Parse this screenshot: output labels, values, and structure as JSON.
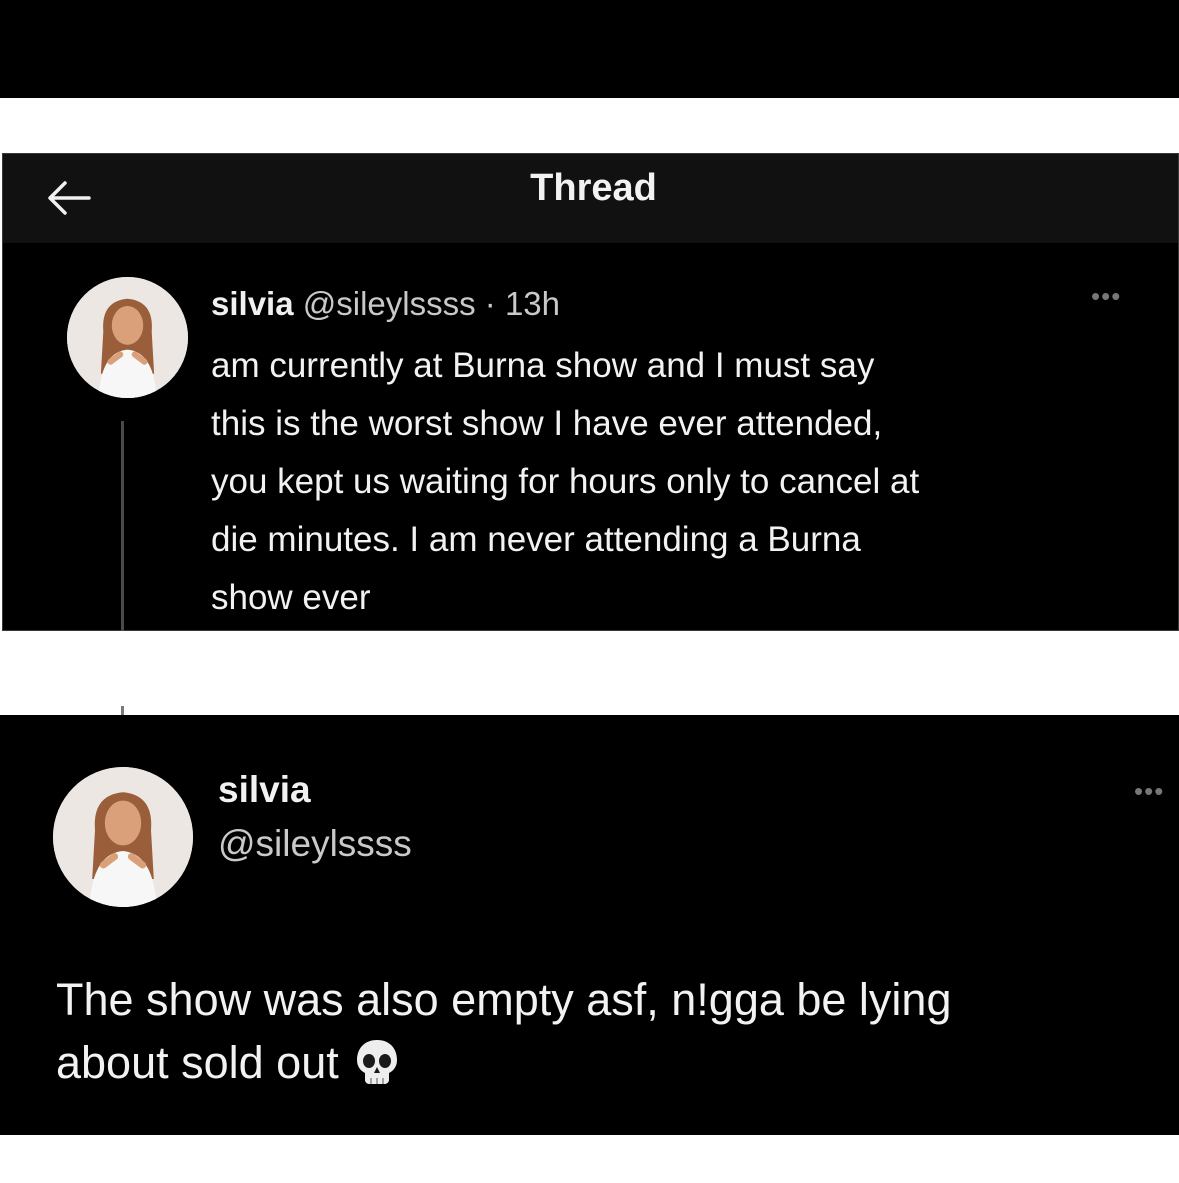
{
  "thread_card": {
    "title": "Thread",
    "tweet": {
      "author_name": "silvia",
      "handle": "@sileylssss",
      "dot": "·",
      "time": "13h",
      "more": "•••",
      "lines": [
        "am currently at Burna show and I must say",
        "this is the worst show I have ever attended,",
        "you kept us waiting for hours only to cancel at",
        "die minutes. I am never attending a Burna",
        "show ever"
      ]
    }
  },
  "detail_card": {
    "author_name": "silvia",
    "handle": "@sileylssss",
    "more": "•••",
    "lines": [
      "The show was also empty asf, n!gga be lying",
      "about sold out"
    ],
    "emoji_icon": "skull-icon"
  },
  "colors": {
    "background": "#000000",
    "text": "#f2f2f2",
    "muted": "#c9c9c9",
    "header": "#111111"
  }
}
